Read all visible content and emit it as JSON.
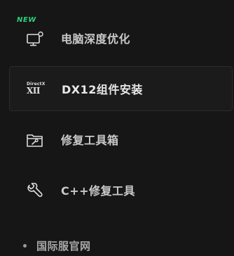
{
  "menu": {
    "items": [
      {
        "label": "电脑深度优化",
        "badge": "NEW",
        "icon": "monitor-settings-icon",
        "active": false
      },
      {
        "label": "DX12组件安装",
        "icon": "directx-icon",
        "icon_text_top": "DirectX",
        "icon_text_bottom": "XII",
        "active": true
      },
      {
        "label": "修复工具箱",
        "icon": "toolbox-wrench-icon",
        "active": false
      },
      {
        "label": "C++修复工具",
        "icon": "wrench-icon",
        "active": false
      }
    ]
  },
  "footer": {
    "link_label": "国际服官网"
  },
  "colors": {
    "background": "#161616",
    "active_item_bg": "#1b1b1b",
    "active_item_border": "#2c2c2c",
    "badge_new": "#2ecf7a",
    "label": "#c9c9c9"
  }
}
